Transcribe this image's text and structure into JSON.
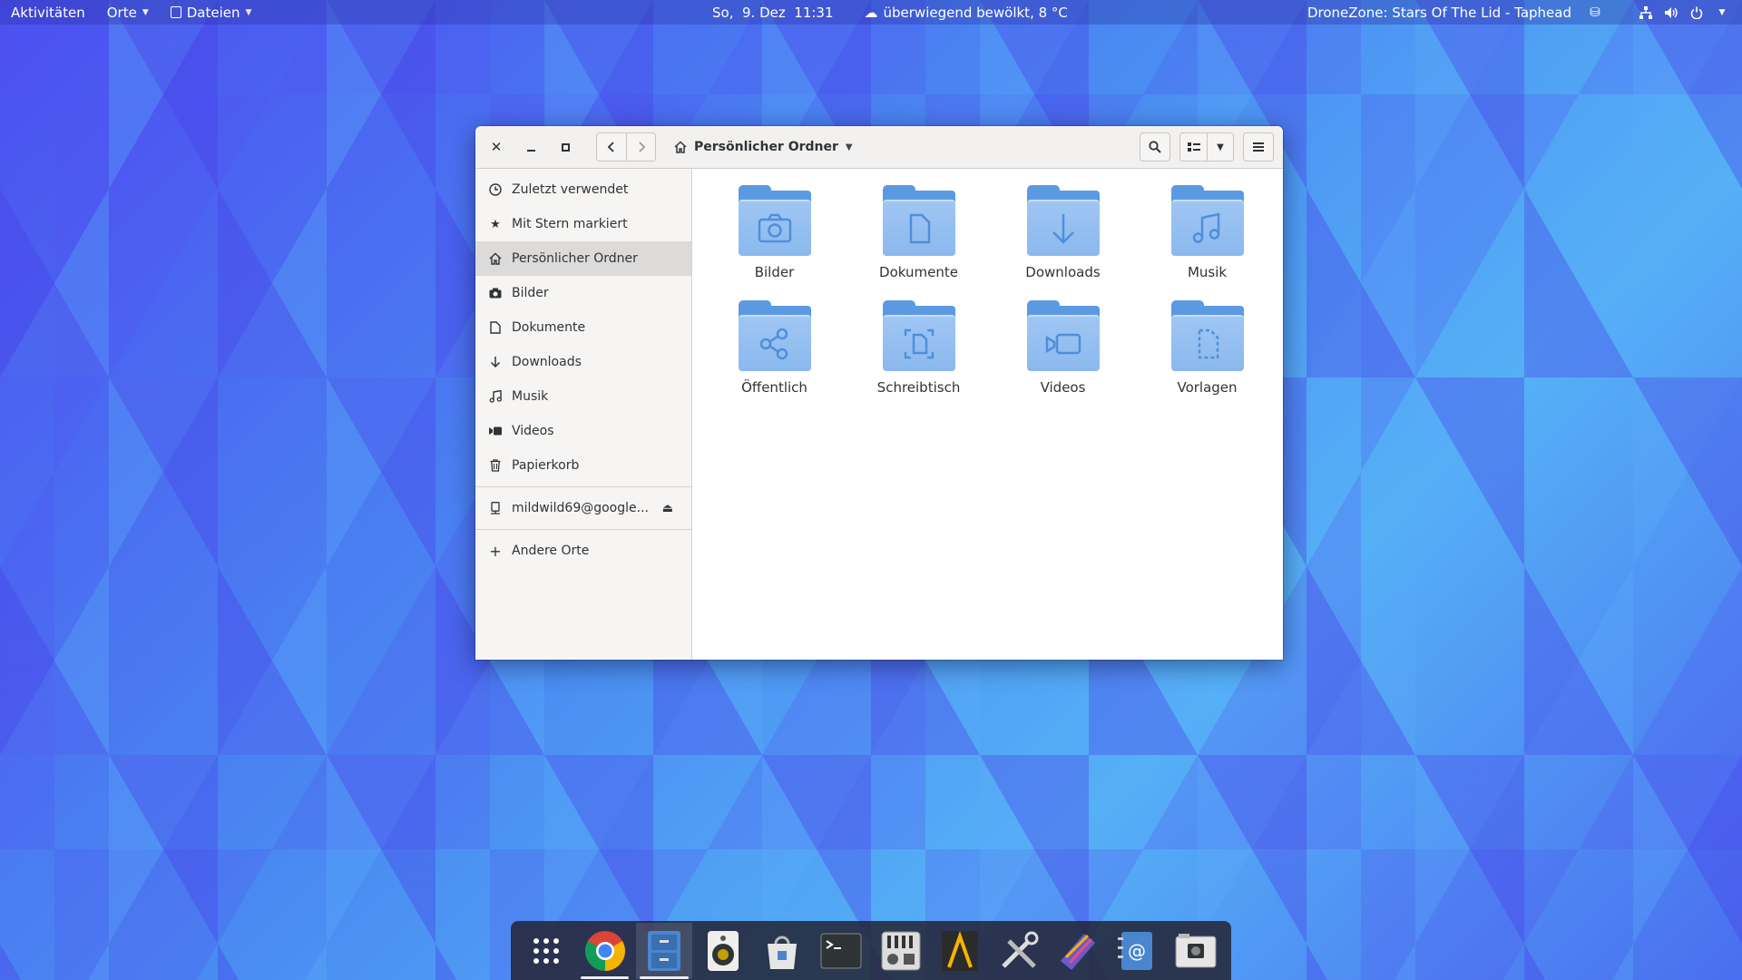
{
  "topbar": {
    "activities": "Aktivitäten",
    "places": "Orte",
    "app_menu": "Dateien",
    "clock": "So,  9. Dez  11:31",
    "weather": "überwiegend bewölkt, 8 °C",
    "now_playing": "DroneZone: Stars Of The Lid - Taphead",
    "tray_icons": [
      "drive-icon",
      "network-icon",
      "volume-icon",
      "power-icon"
    ]
  },
  "window": {
    "path_label": "Persönlicher Ordner",
    "sidebar": {
      "items": [
        {
          "label": "Zuletzt verwendet",
          "icon": "clock-icon"
        },
        {
          "label": "Mit Stern markiert",
          "icon": "star-icon"
        },
        {
          "label": "Persönlicher Ordner",
          "icon": "home-icon",
          "active": true
        },
        {
          "label": "Bilder",
          "icon": "camera-icon"
        },
        {
          "label": "Dokumente",
          "icon": "document-icon"
        },
        {
          "label": "Downloads",
          "icon": "download-icon"
        },
        {
          "label": "Musik",
          "icon": "music-icon"
        },
        {
          "label": "Videos",
          "icon": "video-icon"
        },
        {
          "label": "Papierkorb",
          "icon": "trash-icon"
        }
      ],
      "mount": {
        "label": "mildwild69@google...",
        "icon": "remote-drive-icon"
      },
      "other": {
        "label": "Andere Orte",
        "icon": "plus-icon"
      }
    },
    "folders": [
      {
        "label": "Bilder",
        "emblem": "camera"
      },
      {
        "label": "Dokumente",
        "emblem": "document"
      },
      {
        "label": "Downloads",
        "emblem": "download"
      },
      {
        "label": "Musik",
        "emblem": "music"
      },
      {
        "label": "Öffentlich",
        "emblem": "share"
      },
      {
        "label": "Schreibtisch",
        "emblem": "desktop"
      },
      {
        "label": "Videos",
        "emblem": "video"
      },
      {
        "label": "Vorlagen",
        "emblem": "template"
      }
    ]
  },
  "dock": {
    "items": [
      {
        "name": "app-grid-icon"
      },
      {
        "name": "chrome-icon",
        "running": true
      },
      {
        "name": "files-icon",
        "running": true,
        "focused": true
      },
      {
        "name": "rhythmbox-icon"
      },
      {
        "name": "software-icon"
      },
      {
        "name": "terminal-icon"
      },
      {
        "name": "mixer-icon"
      },
      {
        "name": "text-editor-icon"
      },
      {
        "name": "tools-icon"
      },
      {
        "name": "design-icon"
      },
      {
        "name": "contacts-icon"
      },
      {
        "name": "screenshot-icon"
      }
    ]
  }
}
